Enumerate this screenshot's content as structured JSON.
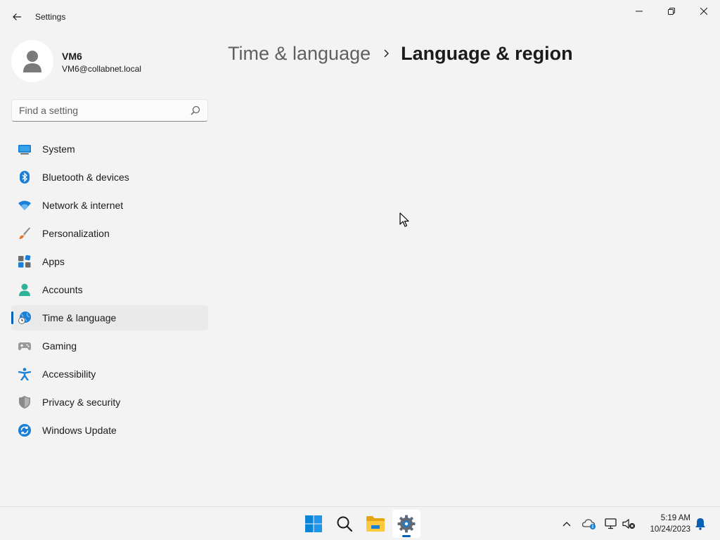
{
  "window": {
    "app_title": "Settings"
  },
  "profile": {
    "name": "VM6",
    "email": "VM6@collabnet.local"
  },
  "search": {
    "placeholder": "Find a setting"
  },
  "sidebar": {
    "items": [
      {
        "label": "System",
        "icon": "system-icon"
      },
      {
        "label": "Bluetooth & devices",
        "icon": "bluetooth-icon"
      },
      {
        "label": "Network & internet",
        "icon": "wifi-icon"
      },
      {
        "label": "Personalization",
        "icon": "brush-icon"
      },
      {
        "label": "Apps",
        "icon": "apps-icon"
      },
      {
        "label": "Accounts",
        "icon": "accounts-icon"
      },
      {
        "label": "Time & language",
        "icon": "globe-clock-icon",
        "selected": true
      },
      {
        "label": "Gaming",
        "icon": "gamepad-icon"
      },
      {
        "label": "Accessibility",
        "icon": "accessibility-icon"
      },
      {
        "label": "Privacy & security",
        "icon": "shield-icon"
      },
      {
        "label": "Windows Update",
        "icon": "update-icon"
      }
    ]
  },
  "breadcrumb": {
    "parent": "Time & language",
    "current": "Language & region"
  },
  "taskbar": {
    "time": "5:19 AM",
    "date": "10/24/2023"
  },
  "colors": {
    "accent": "#005fb8",
    "background": "#f3f3f3"
  }
}
